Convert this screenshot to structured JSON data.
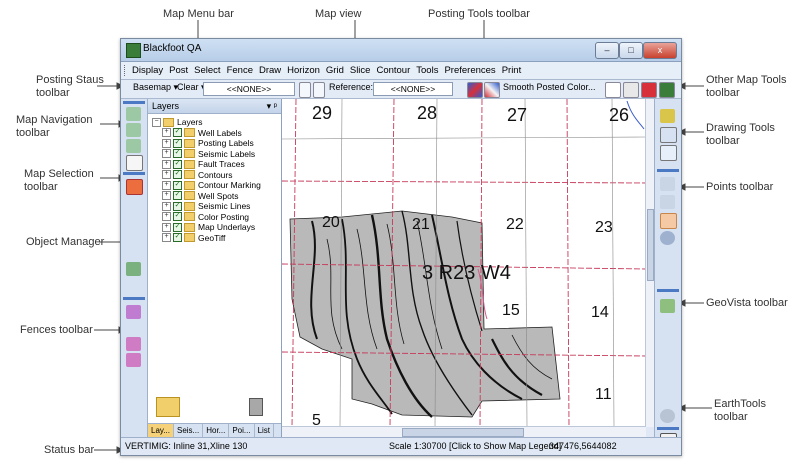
{
  "callouts": {
    "map_menu_bar": "Map Menu bar",
    "map_view": "Map view",
    "posting_tools_toolbar": "Posting Tools toolbar",
    "posting_status_toolbar": "Posting Staus\ntoolbar",
    "other_map_tools_toolbar": "Other Map Tools\ntoolbar",
    "map_navigation_toolbar": "Map Navigation\ntoolbar",
    "drawing_tools_toolbar": "Drawing Tools\ntoolbar",
    "map_selection_toolbar": "Map Selection\ntoolbar",
    "points_toolbar": "Points toolbar",
    "object_manager": "Object Manager",
    "geovista_toolbar": "GeoVista toolbar",
    "fences_toolbar": "Fences toolbar",
    "earthtools_toolbar": "EarthTools\ntoolbar",
    "status_bar": "Status bar"
  },
  "window": {
    "title": "Blackfoot QA",
    "minimize": "–",
    "maximize": "□",
    "close": "x"
  },
  "menu": [
    "Display",
    "Post",
    "Select",
    "Fence",
    "Draw",
    "Horizon",
    "Grid",
    "Slice",
    "Contour",
    "Tools",
    "Preferences",
    "Print"
  ],
  "posting_status": {
    "basemap": "Basemap ▾",
    "clear": "Clear ▾",
    "combo1": "<<NONE>>",
    "reference_label": "Reference:",
    "combo2": "<<NONE>>",
    "smooth_posted_color": "Smooth Posted Color..."
  },
  "object_manager": {
    "title": "Layers",
    "pin": "▾ ᵖ",
    "root": "Layers",
    "layers": [
      "Well Labels",
      "Posting Labels",
      "Seismic Labels",
      "Fault Traces",
      "Contours",
      "Contour Marking",
      "Well Spots",
      "Seismic Lines",
      "Color Posting",
      "Map Underlays",
      "GeoTiff"
    ],
    "tabs": [
      "Lay...",
      "Seis...",
      "Hor...",
      "Poi...",
      "List"
    ]
  },
  "map": {
    "section_numbers": [
      "29",
      "28",
      "27",
      "26",
      "20",
      "21",
      "22",
      "23",
      "15",
      "14",
      "11",
      "5"
    ],
    "township_label": "3 R23 W4"
  },
  "status": {
    "left": "VERTIMIG: Inline 31,Xline 130",
    "scale": "Scale 1:30700 [Click to Show Map Legend]",
    "coords": "347476,5644082"
  },
  "colors": {
    "accent": "#4b79c4",
    "geology_fill": "#b9b9b9",
    "grid_line": "#c53a5a"
  }
}
